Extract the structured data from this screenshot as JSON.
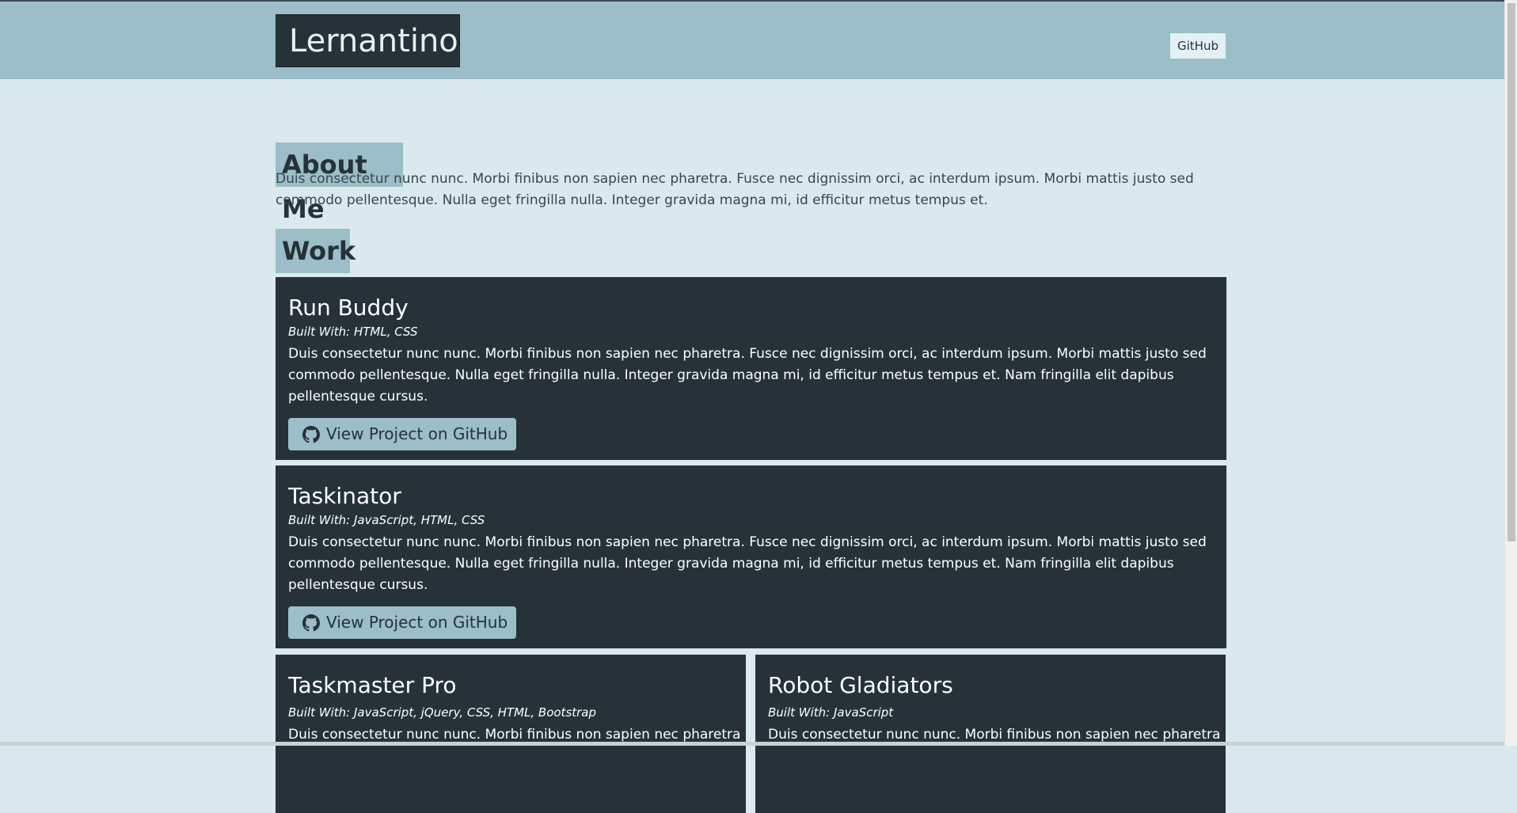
{
  "header": {
    "brand": "Lernantino",
    "nav_link": "GitHub"
  },
  "about": {
    "heading": "About Me",
    "text": "Duis consectetur nunc nunc. Morbi finibus non sapien nec pharetra. Fusce nec dignissim orci, ac interdum ipsum. Morbi mattis justo sed commodo pellentesque. Nulla eget fringilla nulla. Integer gravida magna mi, id efficitur metus tempus et."
  },
  "work": {
    "heading": "Work",
    "projects": [
      {
        "title": "Run Buddy",
        "built_with": "Built With: HTML, CSS",
        "description": "Duis consectetur nunc nunc. Morbi finibus non sapien nec pharetra. Fusce nec dignissim orci, ac interdum ipsum. Morbi mattis justo sed commodo pellentesque. Nulla eget fringilla nulla. Integer gravida magna mi, id efficitur metus tempus et. Nam fringilla elit dapibus pellentesque cursus.",
        "button_label": "View Project on GitHub"
      },
      {
        "title": "Taskinator",
        "built_with": "Built With: JavaScript, HTML, CSS",
        "description": "Duis consectetur nunc nunc. Morbi finibus non sapien nec pharetra. Fusce nec dignissim orci, ac interdum ipsum. Morbi mattis justo sed commodo pellentesque. Nulla eget fringilla nulla. Integer gravida magna mi, id efficitur metus tempus et. Nam fringilla elit dapibus pellentesque cursus.",
        "button_label": "View Project on GitHub"
      },
      {
        "title": "Taskmaster Pro",
        "built_with": "Built With: JavaScript, jQuery, CSS, HTML, Bootstrap",
        "description": "Duis consectetur nunc nunc. Morbi finibus non sapien nec pharetra."
      },
      {
        "title": "Robot Gladiators",
        "built_with": "Built With: JavaScript",
        "description": "Duis consectetur nunc nunc. Morbi finibus non sapien nec pharetra."
      }
    ]
  },
  "icons": {
    "github": "github-icon"
  },
  "colors": {
    "page_bg": "#d9e9ee",
    "header_bg": "#9bbec8",
    "dark": "#263238",
    "accent": "#9bbec8"
  }
}
